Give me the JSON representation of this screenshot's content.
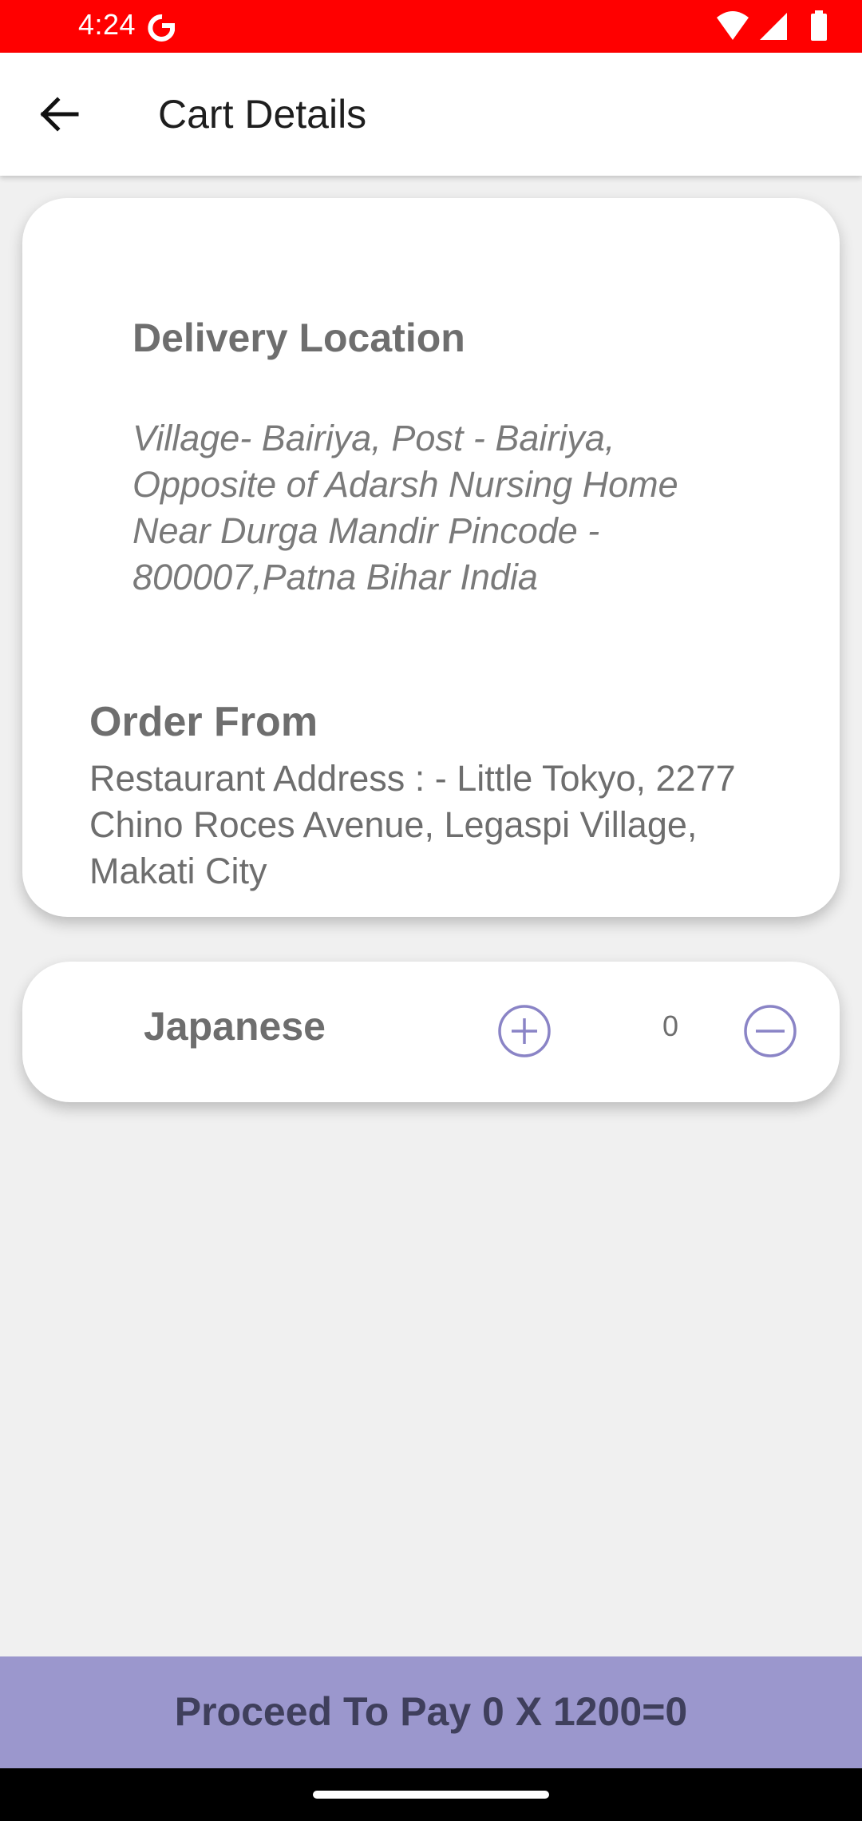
{
  "status_bar": {
    "time": "4:24",
    "bg_color": "#ff0000",
    "icons": [
      "google-g-icon",
      "wifi-icon",
      "signal-icon",
      "battery-icon"
    ]
  },
  "app_bar": {
    "title": "Cart Details",
    "back_icon": "arrow-back-icon"
  },
  "delivery": {
    "title": "Delivery Location",
    "address": "Village- Bairiya, Post - Bairiya, Opposite of Adarsh Nursing Home Near Durga Mandir Pincode - 800007,Patna Bihar India"
  },
  "order_from": {
    "title": "Order From",
    "address": "Restaurant Address : - Little Tokyo, 2277 Chino Roces Avenue, Legaspi Village, Makati City"
  },
  "cart_item": {
    "name": "Japanese",
    "quantity": "0",
    "add_icon": "plus-circle-icon",
    "remove_icon": "minus-circle-icon",
    "accent_color": "#8a84c6"
  },
  "pay_button": {
    "label": "Proceed To Pay 0 X 1200=0",
    "bg_color": "#9b97cd"
  }
}
